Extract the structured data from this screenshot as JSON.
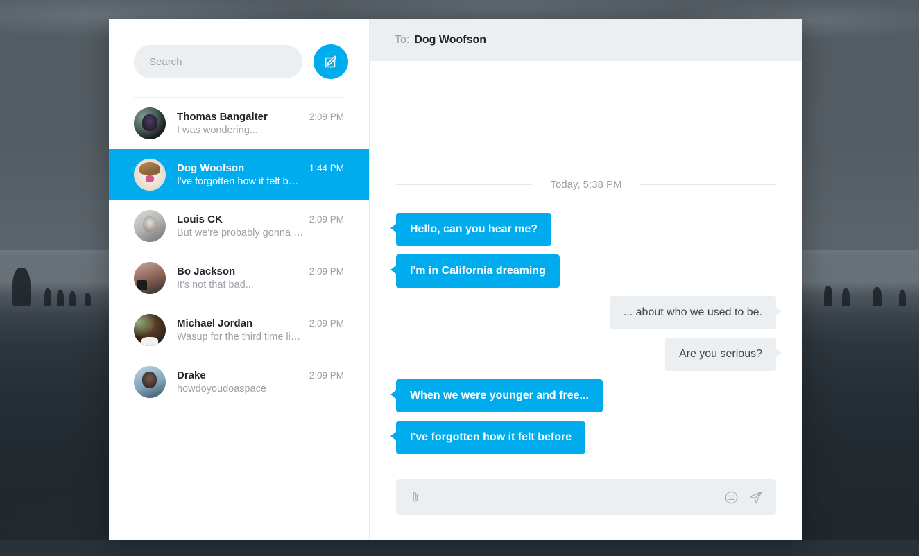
{
  "app": {
    "sidebar": {
      "search": {
        "placeholder": "Search",
        "value": ""
      },
      "compose_button_label": "compose",
      "conversations": [
        {
          "name": "Thomas Bangalter",
          "time": "2:09 PM",
          "preview": "I was wondering...",
          "avatar": "av-thomas",
          "selected": false
        },
        {
          "name": "Dog Woofson",
          "time": "1:44 PM",
          "preview": "I've forgotten how it felt b…",
          "avatar": "av-dog",
          "selected": true
        },
        {
          "name": "Louis CK",
          "time": "2:09 PM",
          "preview": "But we're probably gonna …",
          "avatar": "av-louis",
          "selected": false
        },
        {
          "name": "Bo Jackson",
          "time": "2:09 PM",
          "preview": "It's not that bad...",
          "avatar": "av-bo",
          "selected": false
        },
        {
          "name": "Michael Jordan",
          "time": "2:09 PM",
          "preview": "Wasup for the third time li…",
          "avatar": "av-mj",
          "selected": false
        },
        {
          "name": "Drake",
          "time": "2:09 PM",
          "preview": "howdoyoudoaspace",
          "avatar": "av-drake",
          "selected": false
        }
      ]
    },
    "chat": {
      "header": {
        "to_label": "To:",
        "recipient": "Dog Woofson"
      },
      "date_divider": "Today, 5:38 PM",
      "messages": [
        {
          "text": "Hello, can you hear me?",
          "direction": "sent"
        },
        {
          "text": "I'm in California dreaming",
          "direction": "sent"
        },
        {
          "text": "... about who we used to be.",
          "direction": "received"
        },
        {
          "text": "Are you serious?",
          "direction": "received"
        },
        {
          "text": "When we were younger and free...",
          "direction": "sent"
        },
        {
          "text": "I've forgotten how it felt before",
          "direction": "sent"
        }
      ],
      "composer": {
        "placeholder": "",
        "value": "",
        "attach_icon": "paperclip-icon",
        "emoji_icon": "smiley-icon",
        "send_icon": "paper-plane-icon"
      }
    }
  },
  "colors": {
    "accent": "#00aced",
    "panel_gray": "#eceff1",
    "text_muted": "#9aa1a8",
    "text_dark": "#22262a",
    "desktop_bar": "#283238"
  }
}
